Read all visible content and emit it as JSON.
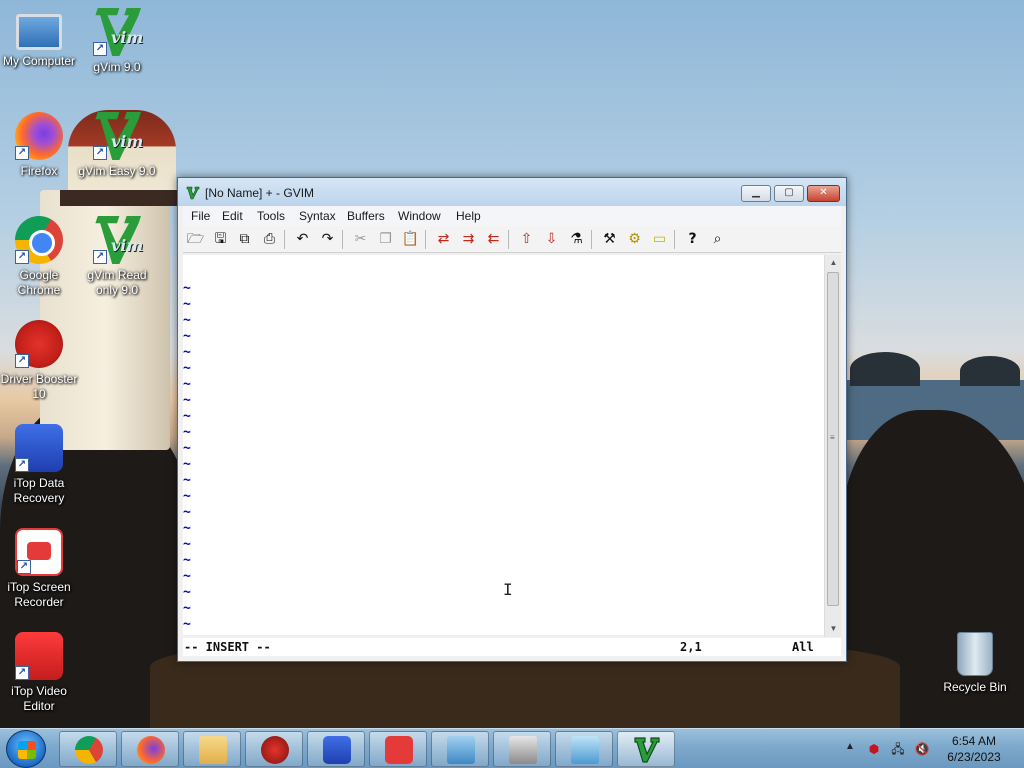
{
  "desktop": {
    "icons": [
      {
        "label": "My Computer"
      },
      {
        "label": "gVim 9.0"
      },
      {
        "label": "Firefox"
      },
      {
        "label": "gVim Easy 9.0"
      },
      {
        "label": "Google Chrome"
      },
      {
        "label": "gVim Read only 9.0"
      },
      {
        "label": "Driver Booster 10"
      },
      {
        "label": "iTop Data Recovery"
      },
      {
        "label": "iTop Screen Recorder"
      },
      {
        "label": "iTop Video Editor"
      },
      {
        "label": "Recycle Bin"
      }
    ]
  },
  "gvim": {
    "title": "[No Name] + - GVIM",
    "vim_logo_text": "vim",
    "menu": [
      "File",
      "Edit",
      "Tools",
      "Syntax",
      "Buffers",
      "Window",
      "Help"
    ],
    "toolbar_icons": [
      "open-icon",
      "save-icon",
      "save-all-icon",
      "print-icon",
      "undo-icon",
      "redo-icon",
      "cut-icon",
      "copy-icon",
      "paste-icon",
      "find-replace-icon",
      "find-next-icon",
      "find-prev-icon",
      "load-session-icon",
      "save-session-icon",
      "run-script-icon",
      "make-icon",
      "run-ctags-icon",
      "jump-tag-icon",
      "help-icon",
      "find-help-icon"
    ],
    "tilde": "~",
    "tilde_lines": 22,
    "status": {
      "mode": "-- INSERT --",
      "position": "2,1",
      "scroll": "All"
    }
  },
  "taskbar": {
    "apps": [
      "Google Chrome",
      "Firefox",
      "File Explorer",
      "Driver Booster",
      "iTop Data Recovery",
      "iTop Screen Recorder",
      "Control Panel",
      "Printer",
      "Mail",
      "gVim"
    ],
    "clock": {
      "time": "6:54 AM",
      "date": "6/23/2023"
    }
  }
}
